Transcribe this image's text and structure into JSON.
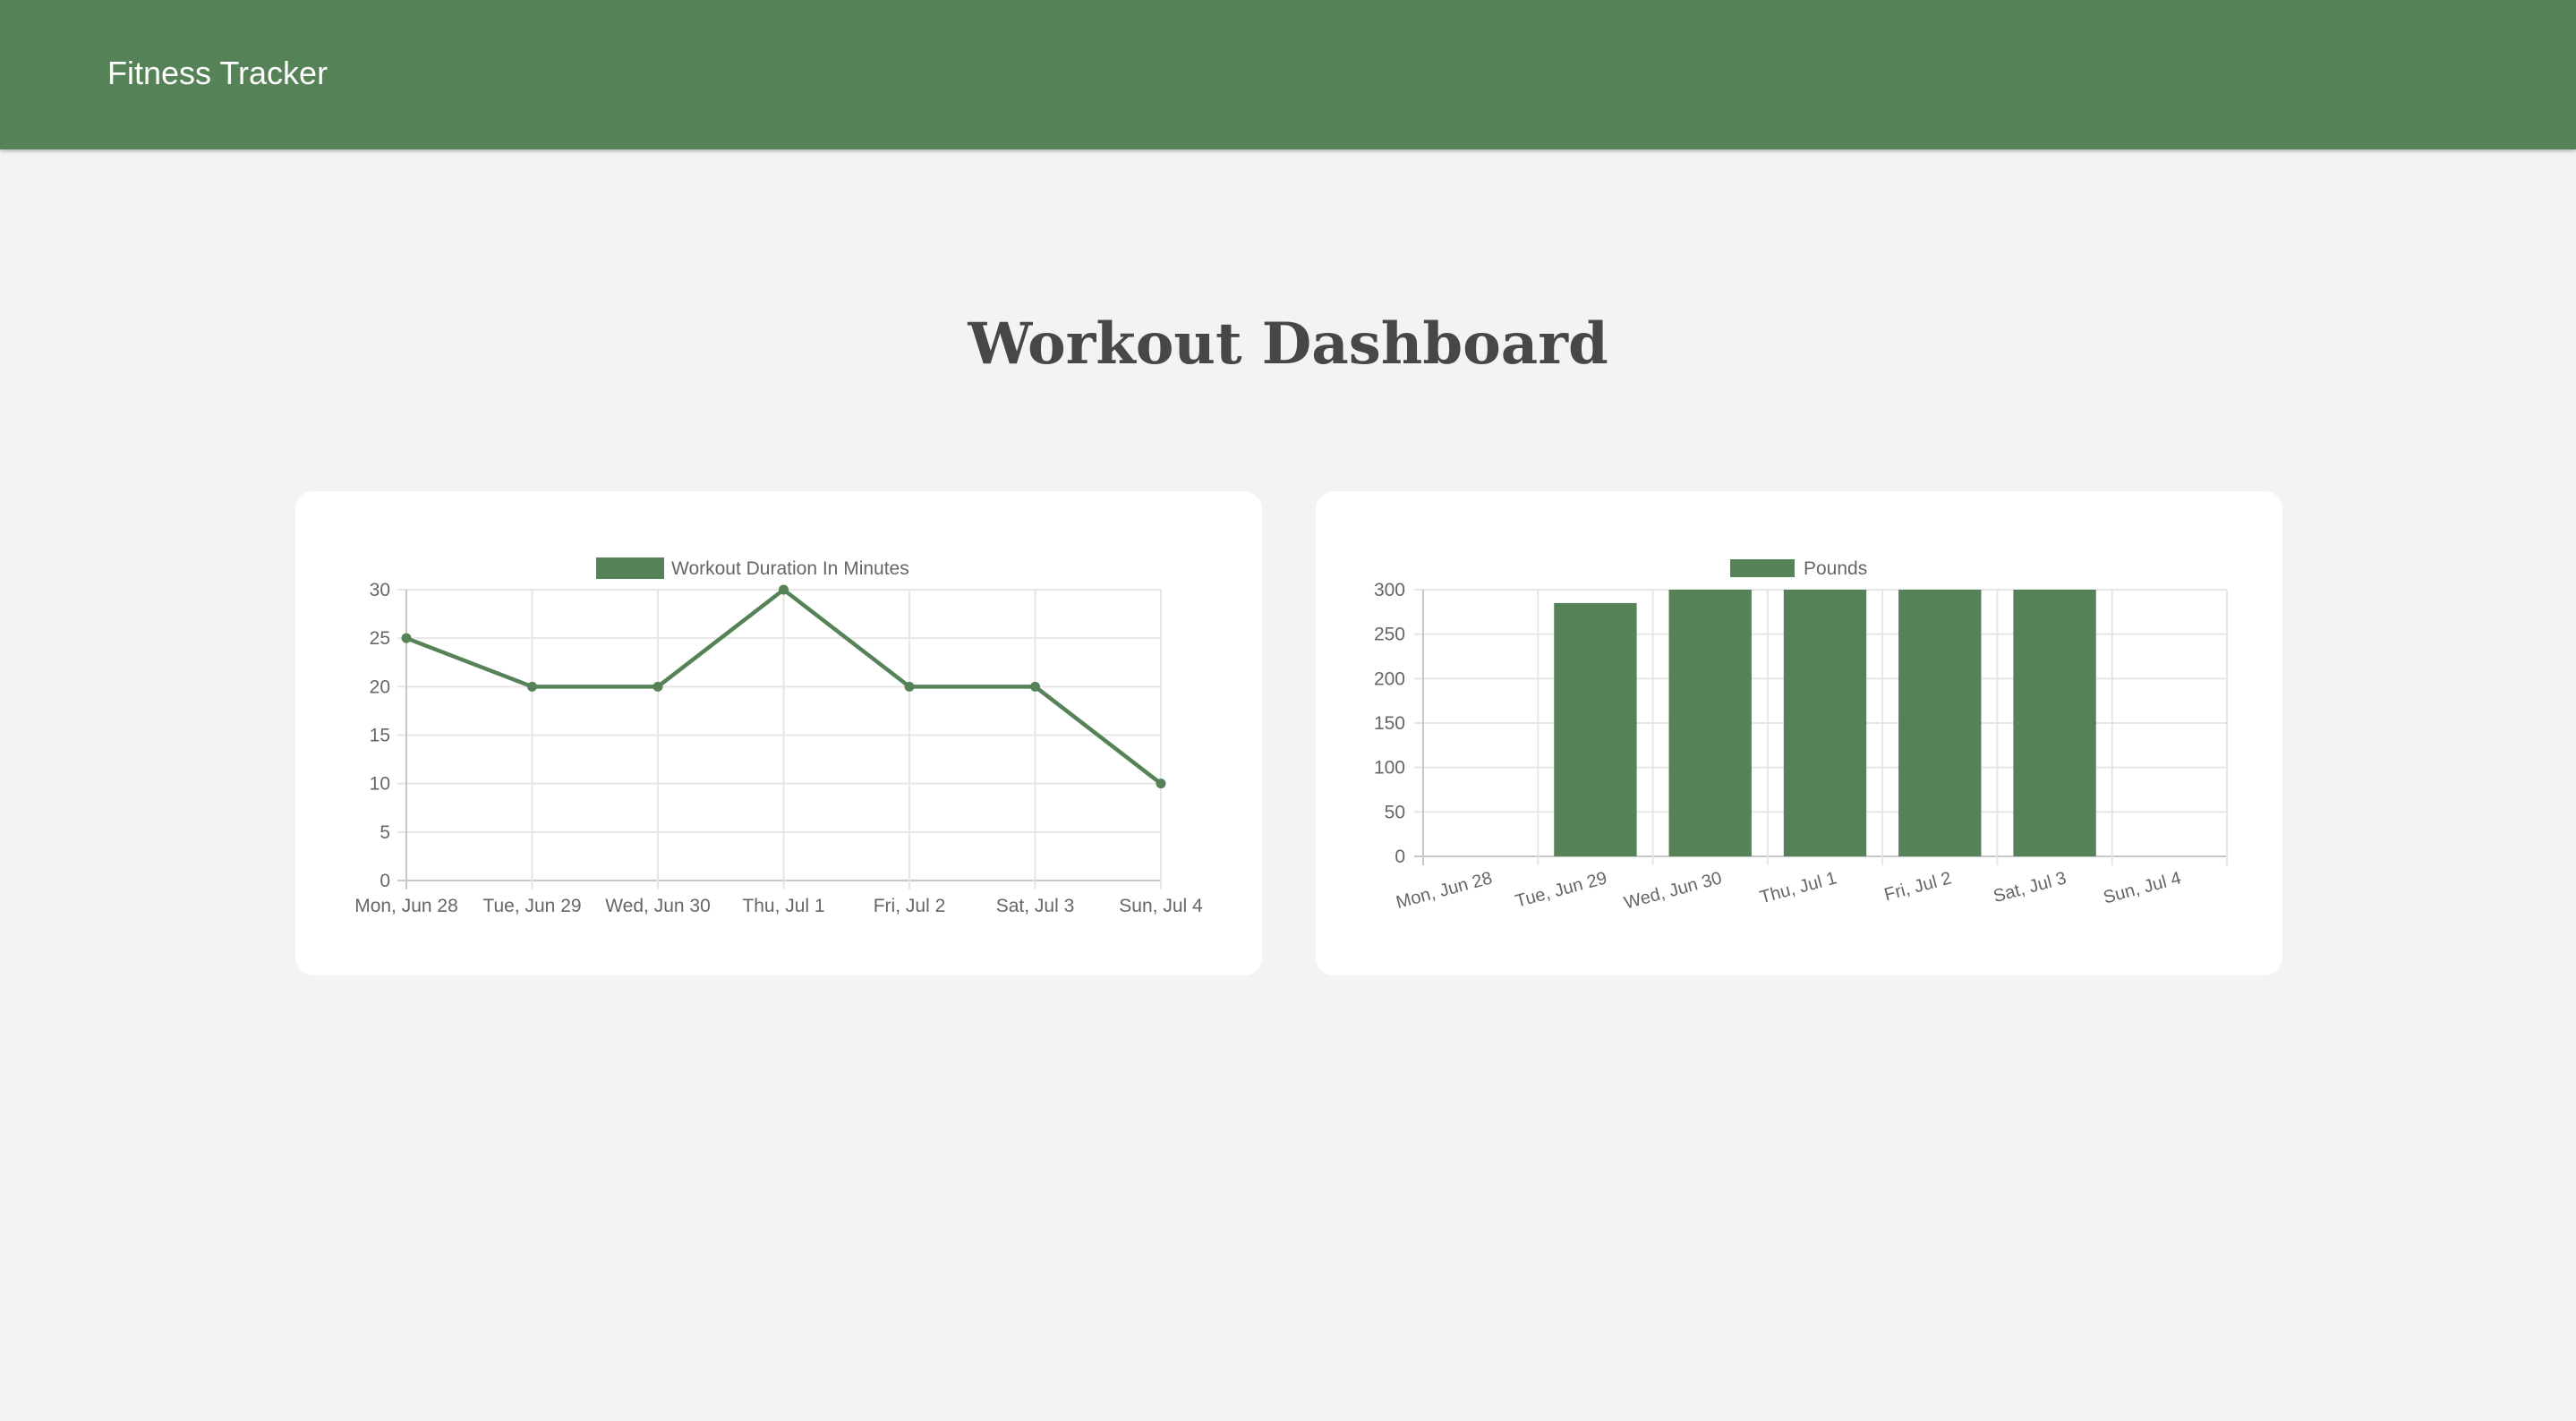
{
  "header": {
    "brand": "Fitness Tracker"
  },
  "main": {
    "title": "Workout Dashboard"
  },
  "colors": {
    "header_bg": "#558257",
    "series": "#558257",
    "page_bg": "#f3f3f3"
  },
  "chart_data": [
    {
      "type": "line",
      "categories": [
        "Mon, Jun 28",
        "Tue, Jun 29",
        "Wed, Jun 30",
        "Thu, Jul 1",
        "Fri, Jul 2",
        "Sat, Jul 3",
        "Sun, Jul 4"
      ],
      "series": [
        {
          "name": "Workout Duration In Minutes",
          "values": [
            25,
            20,
            20,
            30,
            20,
            20,
            10
          ]
        }
      ],
      "ylim": [
        0,
        30
      ],
      "yticks": [
        0,
        5,
        10,
        15,
        20,
        25,
        30
      ],
      "grid": true,
      "legend": "top-center"
    },
    {
      "type": "bar",
      "categories": [
        "Mon, Jun 28",
        "Tue, Jun 29",
        "Wed, Jun 30",
        "Thu, Jul 1",
        "Fri, Jul 2",
        "Sat, Jul 3",
        "Sun, Jul 4"
      ],
      "series": [
        {
          "name": "Pounds",
          "values": [
            0,
            285,
            300,
            300,
            300,
            300,
            0
          ]
        }
      ],
      "ylim": [
        0,
        300
      ],
      "yticks": [
        0,
        50,
        100,
        150,
        200,
        250,
        300
      ],
      "grid": true,
      "legend": "top-center"
    }
  ]
}
